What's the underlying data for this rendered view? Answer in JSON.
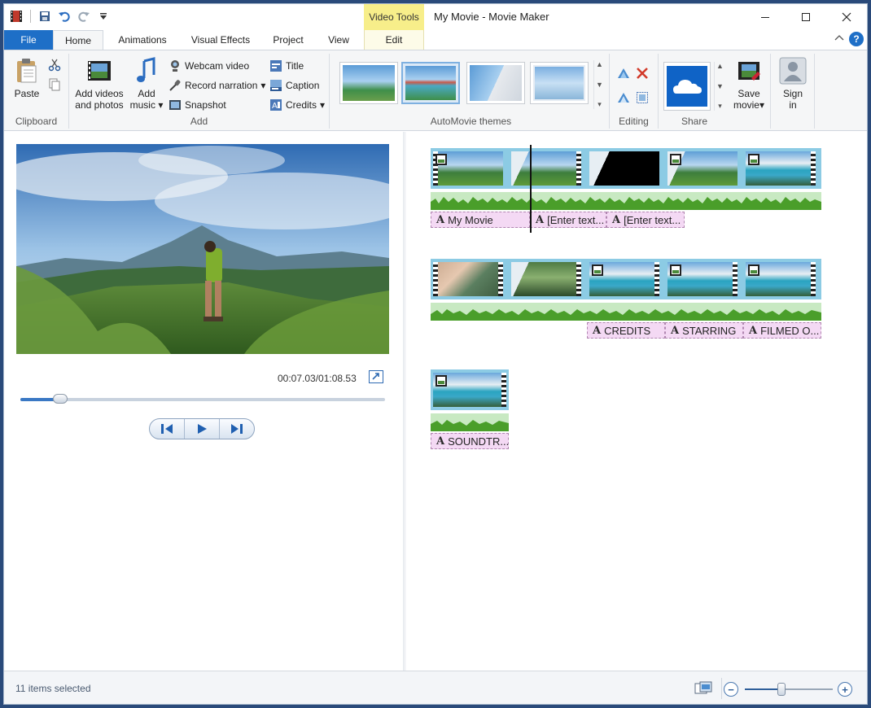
{
  "window": {
    "title": "My Movie - Movie Maker",
    "contextual_tab": "Video Tools",
    "accent": "#1e6fc7",
    "contextual_color": "#f7ee8a"
  },
  "tabs": {
    "file": "File",
    "home": "Home",
    "animations": "Animations",
    "visual_effects": "Visual Effects",
    "project": "Project",
    "view": "View",
    "edit": "Edit"
  },
  "ribbon": {
    "clipboard": {
      "label": "Clipboard",
      "paste": "Paste"
    },
    "add": {
      "label": "Add",
      "add_videos_line1": "Add videos",
      "add_videos_line2": "and photos",
      "add_music_line1": "Add",
      "add_music_line2": "music",
      "webcam": "Webcam video",
      "narration": "Record narration",
      "snapshot": "Snapshot",
      "title": "Title",
      "caption": "Caption",
      "credits": "Credits"
    },
    "automovie": {
      "label": "AutoMovie themes"
    },
    "editing": {
      "label": "Editing"
    },
    "share": {
      "label": "Share",
      "save_line1": "Save",
      "save_line2": "movie",
      "signin_line1": "Sign",
      "signin_line2": "in"
    }
  },
  "preview": {
    "timecode": "00:07.03/01:08.53",
    "seek_fraction": 0.11
  },
  "storyboard": {
    "row1_captions": [
      "My Movie",
      "[Enter text...",
      "[Enter text..."
    ],
    "row2_captions": [
      "CREDITS",
      "STARRING",
      "FILMED O..."
    ],
    "row3_captions": [
      "SOUNDTR..."
    ]
  },
  "status": {
    "text": "11 items selected",
    "zoom_fraction": 0.42
  },
  "icons": {
    "app": "movie-maker-icon",
    "save": "save-icon",
    "undo": "undo-icon",
    "redo": "redo-icon",
    "onedrive": "onedrive-cloud-icon"
  }
}
